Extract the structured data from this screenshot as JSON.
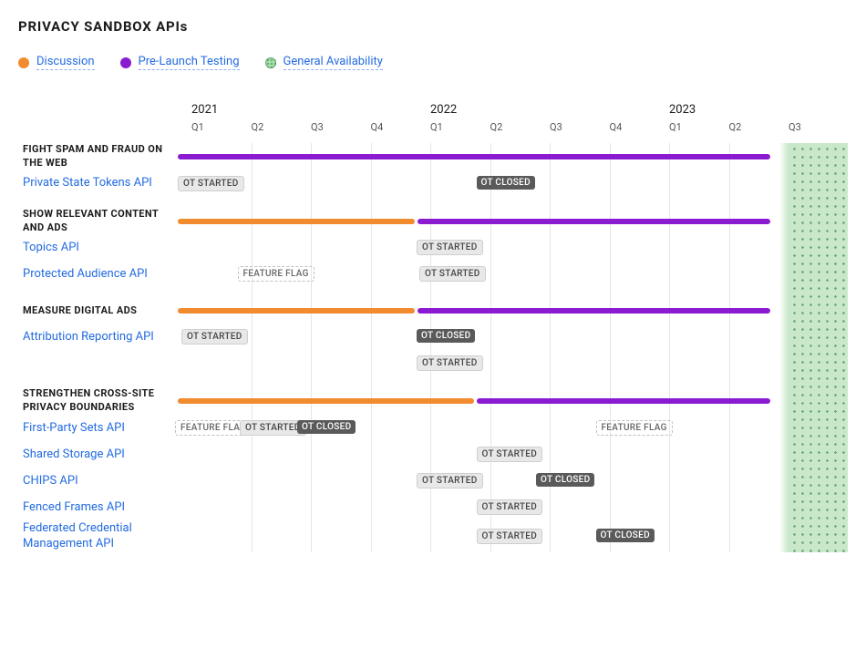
{
  "title": "PRIVACY SANDBOX APIs",
  "legend": {
    "discussion": "Discussion",
    "prelaunch": "Pre-Launch Testing",
    "ga": "General Availability"
  },
  "years": {
    "y2021": "2021",
    "y2022": "2022",
    "y2023": "2023"
  },
  "quarters": [
    "Q1",
    "Q2",
    "Q3",
    "Q4",
    "Q1",
    "Q2",
    "Q3",
    "Q4",
    "Q1",
    "Q2",
    "Q3"
  ],
  "sections": {
    "s1": "FIGHT SPAM AND FRAUD ON THE WEB",
    "s2": "SHOW RELEVANT CONTENT AND ADS",
    "s3": "MEASURE DIGITAL ADS",
    "s4": "STRENGTHEN CROSS-SITE PRIVACY BOUNDARIES"
  },
  "apis": {
    "pst": "Private State Tokens API",
    "topics": "Topics API",
    "pa": "Protected Audience API",
    "ar": "Attribution Reporting API",
    "fps": "First-Party Sets API",
    "ss": "Shared Storage API",
    "chips": "CHIPS API",
    "ff": "Fenced Frames API",
    "fedcm": "Federated Credential Management API"
  },
  "tags": {
    "ot_started": "OT STARTED",
    "ot_closed": "OT CLOSED",
    "feature_flag": "FEATURE FLAG"
  },
  "chart_data": {
    "type": "bar",
    "title": "PRIVACY SANDBOX APIs",
    "xlabel": "",
    "ylabel": "",
    "x_quarters": [
      "2021 Q1",
      "2021 Q2",
      "2021 Q3",
      "2021 Q4",
      "2022 Q1",
      "2022 Q2",
      "2022 Q3",
      "2022 Q4",
      "2023 Q1",
      "2023 Q2",
      "2023 Q3"
    ],
    "legend": [
      "Discussion",
      "Pre-Launch Testing",
      "General Availability"
    ],
    "general_availability_start": "2023 Q3",
    "groups": [
      {
        "name": "FIGHT SPAM AND FRAUD ON THE WEB",
        "phases": [
          {
            "phase": "Pre-Launch Testing",
            "start": "2021 Q1",
            "end": "2023 Q3"
          }
        ],
        "items": [
          {
            "name": "Private State Tokens API",
            "events": [
              {
                "label": "OT STARTED",
                "at": "2021 Q1"
              },
              {
                "label": "OT CLOSED",
                "at": "2022 Q2"
              }
            ]
          }
        ]
      },
      {
        "name": "SHOW RELEVANT CONTENT AND ADS",
        "phases": [
          {
            "phase": "Discussion",
            "start": "2021 Q1",
            "end": "2022 Q1"
          },
          {
            "phase": "Pre-Launch Testing",
            "start": "2022 Q1",
            "end": "2023 Q3"
          }
        ],
        "items": [
          {
            "name": "Topics API",
            "events": [
              {
                "label": "OT STARTED",
                "at": "2022 Q1"
              }
            ]
          },
          {
            "name": "Protected Audience API",
            "events": [
              {
                "label": "FEATURE FLAG",
                "at": "2021 Q2"
              },
              {
                "label": "OT STARTED",
                "at": "2022 Q1"
              }
            ]
          }
        ]
      },
      {
        "name": "MEASURE DIGITAL ADS",
        "phases": [
          {
            "phase": "Discussion",
            "start": "2021 Q1",
            "end": "2022 Q1"
          },
          {
            "phase": "Pre-Launch Testing",
            "start": "2022 Q1",
            "end": "2023 Q3"
          }
        ],
        "items": [
          {
            "name": "Attribution Reporting API",
            "events": [
              {
                "label": "OT STARTED",
                "at": "2021 Q1"
              },
              {
                "label": "OT CLOSED",
                "at": "2022 Q1"
              },
              {
                "label": "OT STARTED",
                "at": "2022 Q1"
              }
            ]
          }
        ]
      },
      {
        "name": "STRENGTHEN CROSS-SITE PRIVACY BOUNDARIES",
        "phases": [
          {
            "phase": "Discussion",
            "start": "2021 Q1",
            "end": "2022 Q2"
          },
          {
            "phase": "Pre-Launch Testing",
            "start": "2022 Q2",
            "end": "2023 Q3"
          }
        ],
        "items": [
          {
            "name": "First-Party Sets API",
            "events": [
              {
                "label": "FEATURE FLAG",
                "at": "2021 Q1"
              },
              {
                "label": "OT STARTED",
                "at": "2021 Q2"
              },
              {
                "label": "OT CLOSED",
                "at": "2021 Q3"
              },
              {
                "label": "FEATURE FLAG",
                "at": "2023 Q1"
              }
            ]
          },
          {
            "name": "Shared Storage API",
            "events": [
              {
                "label": "OT STARTED",
                "at": "2022 Q2"
              }
            ]
          },
          {
            "name": "CHIPS API",
            "events": [
              {
                "label": "OT STARTED",
                "at": "2022 Q1"
              },
              {
                "label": "OT CLOSED",
                "at": "2022 Q3"
              }
            ]
          },
          {
            "name": "Fenced Frames API",
            "events": [
              {
                "label": "OT STARTED",
                "at": "2022 Q2"
              }
            ]
          },
          {
            "name": "Federated Credential Management API",
            "events": [
              {
                "label": "OT STARTED",
                "at": "2022 Q2"
              },
              {
                "label": "OT CLOSED",
                "at": "2023 Q1"
              }
            ]
          }
        ]
      }
    ]
  }
}
